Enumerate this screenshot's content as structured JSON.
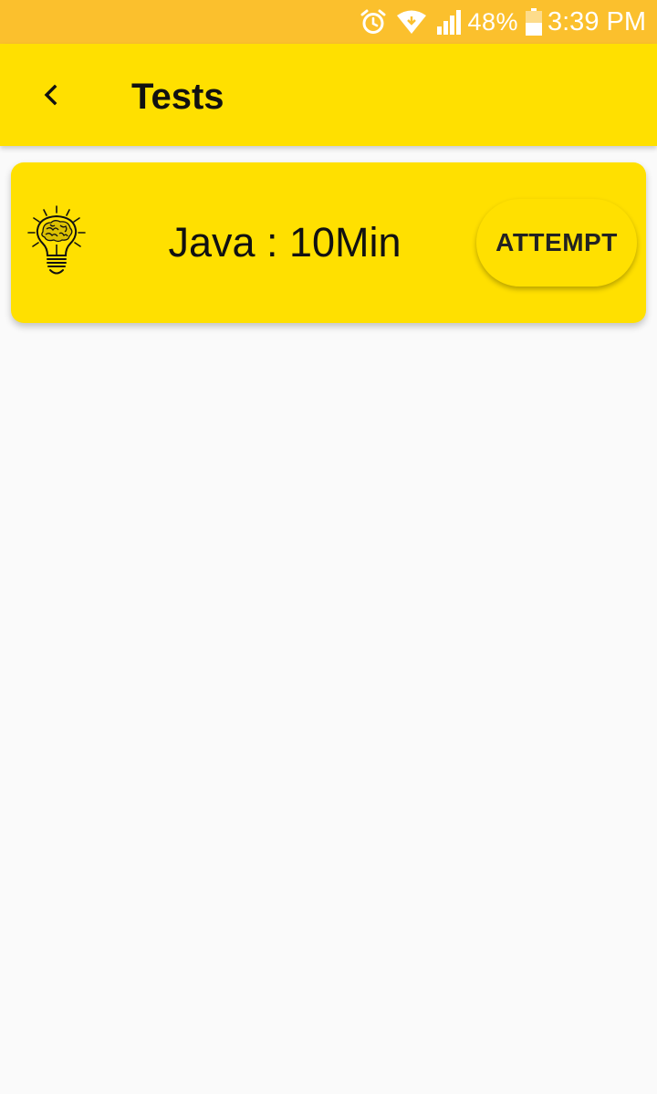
{
  "status_bar": {
    "battery_percent": "48%",
    "time": "3:39 PM",
    "icons": [
      "alarm-icon",
      "wifi-icon",
      "signal-icon",
      "battery-icon"
    ]
  },
  "app_bar": {
    "title": "Tests",
    "back_icon": "chevron-left-icon",
    "background_color": "#ffe000"
  },
  "tests": [
    {
      "name": "Java : 10Min",
      "icon": "lightbulb-brain-icon",
      "action_label": "ATTEMPT"
    }
  ],
  "colors": {
    "status_bar": "#fbc02d",
    "accent": "#ffe000",
    "page_background": "#fafafa"
  }
}
